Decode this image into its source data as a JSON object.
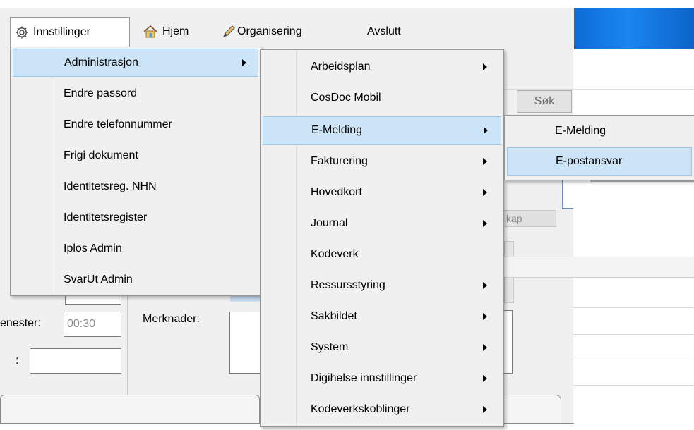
{
  "menubar": {
    "items": [
      {
        "label": "Innstillinger",
        "icon": "gear-icon"
      },
      {
        "label": "Hjem",
        "icon": "home-icon"
      },
      {
        "label": "Organisering",
        "icon": "pencil-icon"
      },
      {
        "label": "Avslutt",
        "icon": ""
      }
    ]
  },
  "background": {
    "search_label": "Søk",
    "tab_fragment": "kap",
    "time_label": "enester:",
    "time_value": "00:30",
    "colon_label": ":",
    "notes_label": "Merknader:"
  },
  "menu_innstillinger": {
    "items": [
      {
        "label": "Administrasjon",
        "submenu": true,
        "highlighted": true
      },
      {
        "label": "Endre passord"
      },
      {
        "label": "Endre telefonnummer"
      },
      {
        "label": "Frigi dokument"
      },
      {
        "label": "Identitetsreg. NHN"
      },
      {
        "label": "Identitetsregister"
      },
      {
        "label": "Iplos Admin"
      },
      {
        "label": "SvarUt Admin"
      }
    ]
  },
  "menu_administrasjon": {
    "items": [
      {
        "label": "Arbeidsplan",
        "submenu": true
      },
      {
        "label": "CosDoc Mobil"
      },
      {
        "label": "E-Melding",
        "submenu": true,
        "highlighted": true
      },
      {
        "label": "Fakturering",
        "submenu": true
      },
      {
        "label": "Hovedkort",
        "submenu": true
      },
      {
        "label": "Journal",
        "submenu": true
      },
      {
        "label": "Kodeverk"
      },
      {
        "label": "Ressursstyring",
        "submenu": true
      },
      {
        "label": "Sakbildet",
        "submenu": true
      },
      {
        "label": "System",
        "submenu": true
      },
      {
        "label": "Digihelse innstillinger",
        "submenu": true
      },
      {
        "label": "Kodeverkskoblinger",
        "submenu": true
      }
    ]
  },
  "menu_emelding": {
    "items": [
      {
        "label": "E-Melding"
      },
      {
        "label": "E-postansvar",
        "highlighted": true
      }
    ]
  },
  "colors": {
    "menu_bg": "#f0f0f0",
    "highlight_bg": "#cce4f7",
    "highlight_border": "#99c9ef",
    "titlebar_blue": "#1a86f0"
  }
}
